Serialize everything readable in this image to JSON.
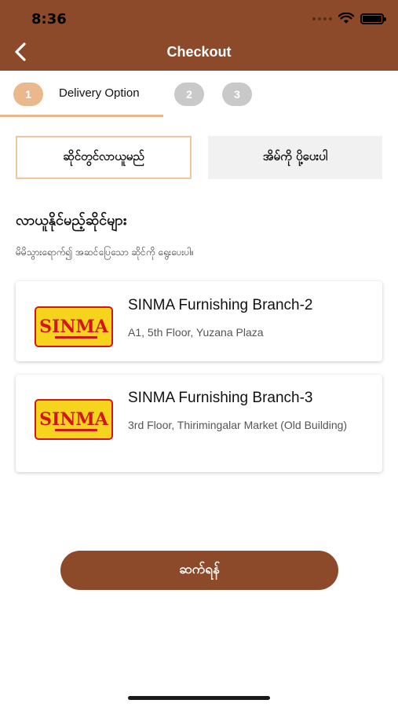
{
  "status_bar": {
    "time": "8:36"
  },
  "header": {
    "title": "Checkout",
    "back_icon": "chevron-left-icon"
  },
  "steps": {
    "items": [
      {
        "number": "1",
        "label": "Delivery Option",
        "active": true
      },
      {
        "number": "2",
        "active": false
      },
      {
        "number": "3",
        "active": false
      }
    ],
    "active_color": "#e9b98d",
    "inactive_color": "#c9c9c9"
  },
  "delivery_options": {
    "pickup_label": "ဆိုင်တွင်လာယူမည်",
    "home_delivery_label": "အိမ်ကို ပို့ပေးပါ",
    "selected": "pickup"
  },
  "section": {
    "title": "လာယူနိုင်မည့်ဆိုင်များ",
    "subtitle": "မိမိသွားရောက်၍ အဆင်ပြေသော ဆိုင်ကို ရွေးပေးပါ။"
  },
  "stores": [
    {
      "logo_text": "SINMA",
      "name": "SINMA Furnishing Branch-2",
      "address": "A1, 5th Floor, Yuzana Plaza"
    },
    {
      "logo_text": "SINMA",
      "name": "SINMA Furnishing Branch-3",
      "address": "3rd Floor, Thirimingalar Market (Old Building)"
    }
  ],
  "continue_button": {
    "label": "ဆက်ရန်"
  },
  "colors": {
    "brand": "#8c4a2b",
    "accent": "#e9b98d",
    "logo_yellow": "#f6d31c",
    "logo_red": "#d4161c"
  }
}
